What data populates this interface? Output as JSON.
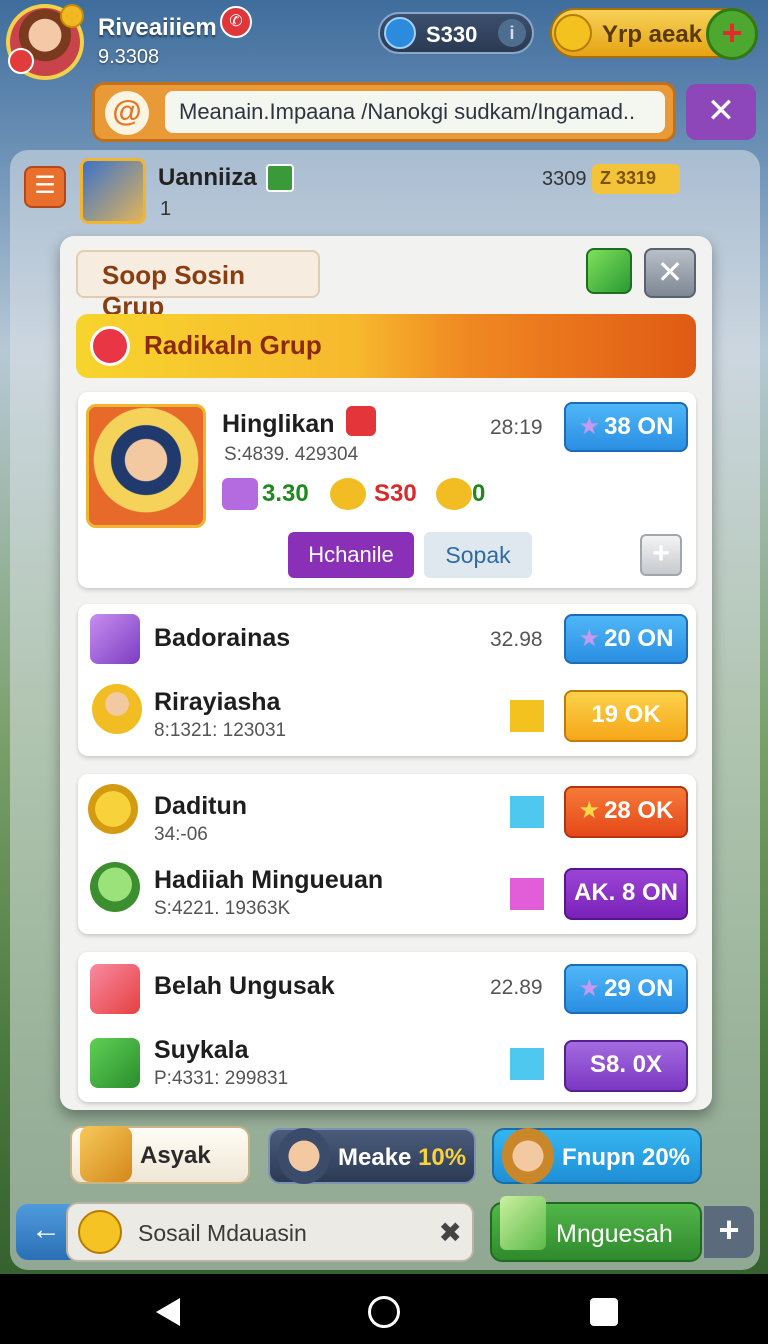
{
  "top": {
    "player_name": "Riveaiiiem",
    "player_score": "9.3308",
    "coin_value": "S330",
    "gold_label": "Yrp aeak"
  },
  "search": {
    "value": "Meanain.Impaana /Nanokgi sudkam/Ingamad.."
  },
  "background_panel": {
    "friend_name": "Uanniiza",
    "friend_sub": "1",
    "score": "3309",
    "tag": "Z 3319"
  },
  "modal": {
    "title": "Soop Sosin Grup",
    "section": "Radikaln Grup",
    "featured": {
      "name": "Hinglikan",
      "id": "S:4839. 429304",
      "time": "28:19",
      "action": "38 ON",
      "stats": [
        "3.30",
        "S30",
        "0"
      ],
      "buttons": [
        "Hchanile",
        "Sopak"
      ]
    },
    "rows": [
      {
        "name": "Badorainas",
        "sub": "",
        "time": "32.98",
        "action": "20 ON",
        "style": "blue"
      },
      {
        "name": "Rirayiasha",
        "sub": "8:1321: 123031",
        "time": "",
        "action": "19 OK",
        "style": "orange"
      },
      {
        "name": "Daditun",
        "sub": "34:-06",
        "time": "",
        "action": "28 OK",
        "style": "red"
      },
      {
        "name": "Hadiiah Mingueuan",
        "sub": "S:4221. 19363K",
        "time": "",
        "action": "AK. 8 ON",
        "style": "purple"
      },
      {
        "name": "Belah Ungusak",
        "sub": "",
        "time": "22.89",
        "action": "29 ON",
        "style": "blue"
      },
      {
        "name": "Suykala",
        "sub": "P:4331: 299831",
        "time": "",
        "action": "S8. 0X",
        "style": "violet"
      }
    ]
  },
  "bottom": {
    "asyak": "Asyak",
    "meake_label": "Meake",
    "meake_pct": "10%",
    "fnupn_label": "Fnupn",
    "fnupn_pct": "20%",
    "search_label": "Sosail Mdauasin",
    "green_action": "Mnguesah"
  },
  "colors": {
    "accent_orange": "#e99a36",
    "accent_purple": "#8e47b8",
    "accent_blue": "#2a8ee2",
    "accent_green": "#4ea82f"
  }
}
